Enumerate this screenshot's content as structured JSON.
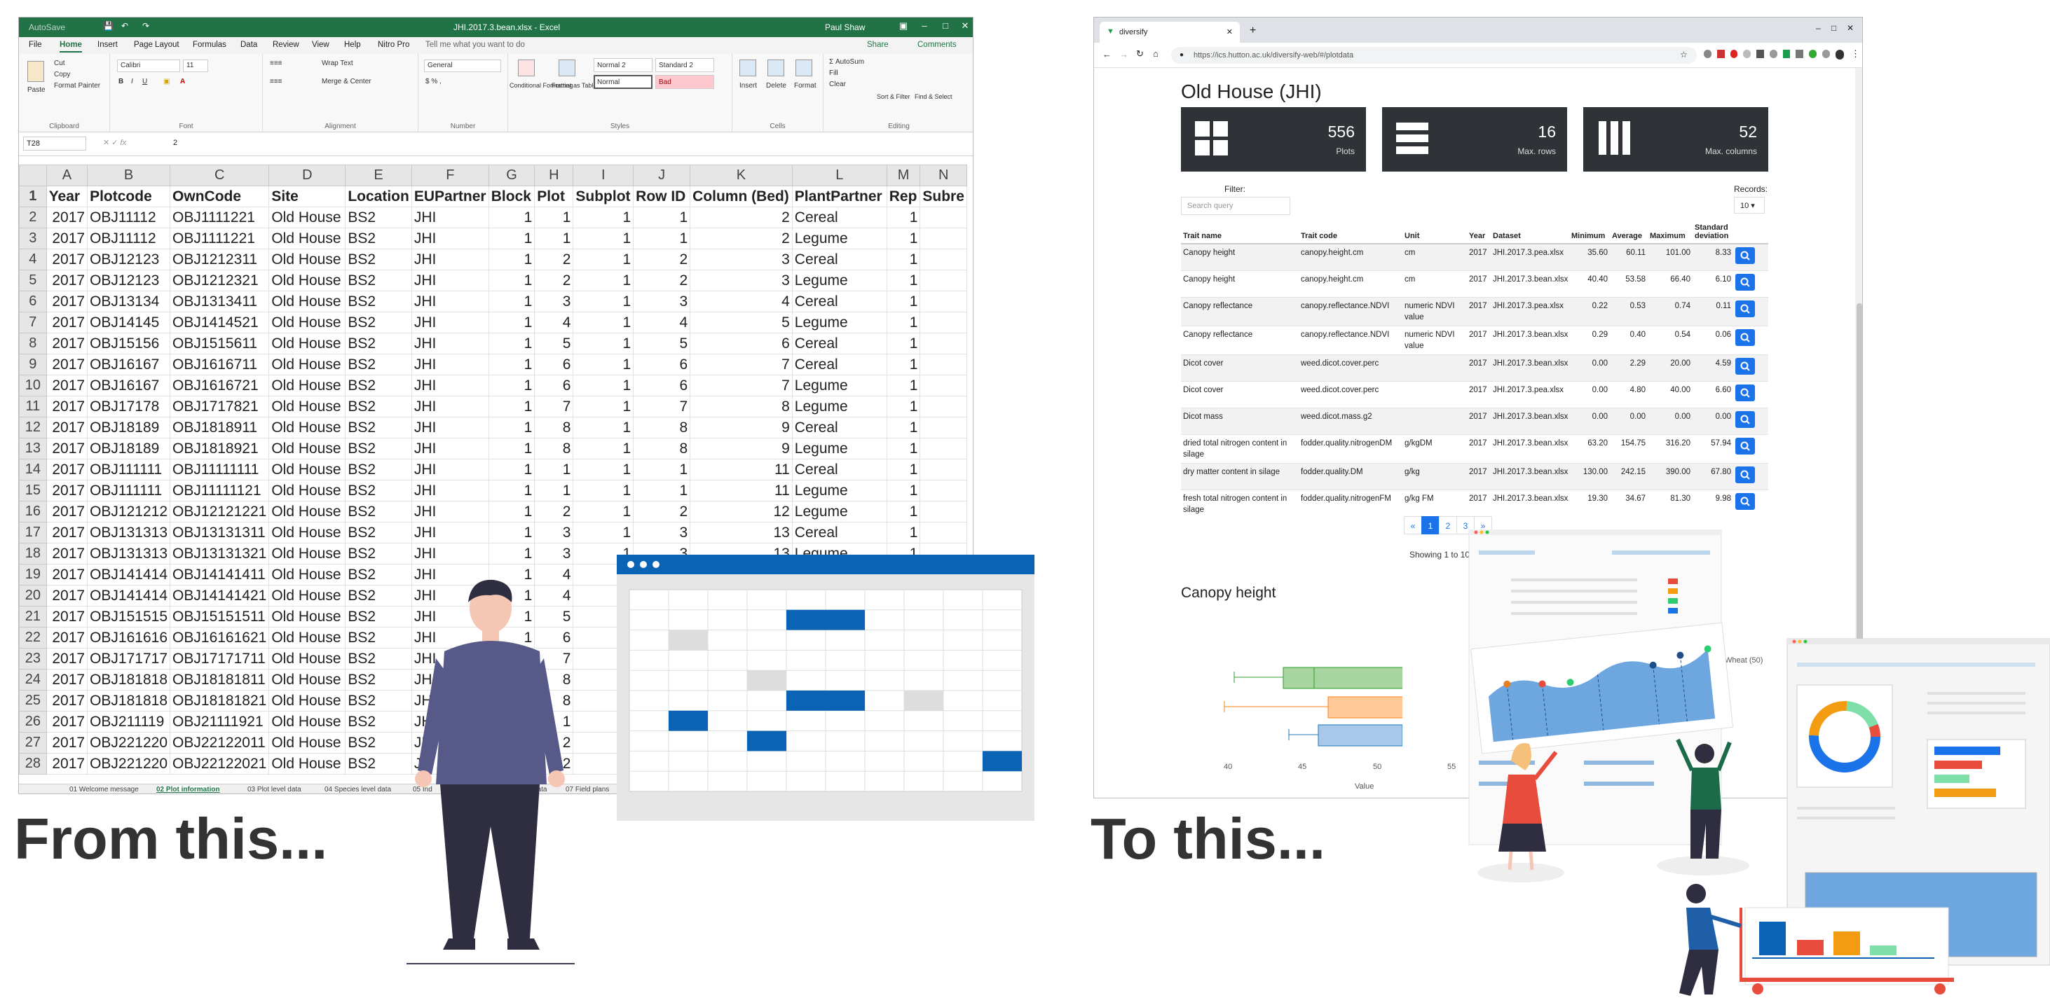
{
  "excel": {
    "title": "JHI.2017.3.bean.xlsx  -  Excel",
    "autosave": "AutoSave",
    "user": "Paul Shaw",
    "menu": [
      "File",
      "Home",
      "Insert",
      "Page Layout",
      "Formulas",
      "Data",
      "Review",
      "View",
      "Help",
      "Nitro Pro"
    ],
    "tell_me": "Tell me what you want to do",
    "share": "Share",
    "comments": "Comments",
    "ribbon": {
      "paste": "Paste",
      "cut": "Cut",
      "copy": "Copy",
      "format_painter": "Format Painter",
      "clipboard": "Clipboard",
      "font_name": "Calibri",
      "font_size": "11",
      "font": "Font",
      "wrap_text": "Wrap Text",
      "merge_center": "Merge & Center",
      "alignment": "Alignment",
      "number_format": "General",
      "number": "Number",
      "cond_format": "Conditional Formatting",
      "format_table": "Format as Table",
      "style_normal2": "Normal 2",
      "style_standard2": "Standard 2",
      "style_normal": "Normal",
      "style_bad": "Bad",
      "styles": "Styles",
      "insert": "Insert",
      "delete": "Delete",
      "format": "Format",
      "cells": "Cells",
      "autosum": "AutoSum",
      "fill": "Fill",
      "clear": "Clear",
      "sort_filter": "Sort & Filter",
      "find_select": "Find & Select",
      "editing": "Editing"
    },
    "name_box": "T28",
    "formula_value": "2",
    "columns": [
      "A",
      "B",
      "C",
      "D",
      "E",
      "F",
      "G",
      "H",
      "I",
      "J",
      "K",
      "L",
      "M",
      "N"
    ],
    "headers": [
      "Year",
      "Plotcode",
      "OwnCode",
      "Site",
      "Location",
      "EUPartner",
      "Block",
      "Plot",
      "Subplot",
      "Row ID",
      "Column (Bed)",
      "PlantPartner",
      "Rep",
      "Subre"
    ],
    "rows": [
      [
        "2017",
        "OBJ11112",
        "OBJ1111221",
        "Old House",
        "BS2",
        "JHI",
        "1",
        "1",
        "1",
        "1",
        "2",
        "Cereal",
        "1"
      ],
      [
        "2017",
        "OBJ11112",
        "OBJ1111221",
        "Old House",
        "BS2",
        "JHI",
        "1",
        "1",
        "1",
        "1",
        "2",
        "Legume",
        "1"
      ],
      [
        "2017",
        "OBJ12123",
        "OBJ1212311",
        "Old House",
        "BS2",
        "JHI",
        "1",
        "2",
        "1",
        "2",
        "3",
        "Cereal",
        "1"
      ],
      [
        "2017",
        "OBJ12123",
        "OBJ1212321",
        "Old House",
        "BS2",
        "JHI",
        "1",
        "2",
        "1",
        "2",
        "3",
        "Legume",
        "1"
      ],
      [
        "2017",
        "OBJ13134",
        "OBJ1313411",
        "Old House",
        "BS2",
        "JHI",
        "1",
        "3",
        "1",
        "3",
        "4",
        "Cereal",
        "1"
      ],
      [
        "2017",
        "OBJ14145",
        "OBJ1414521",
        "Old House",
        "BS2",
        "JHI",
        "1",
        "4",
        "1",
        "4",
        "5",
        "Legume",
        "1"
      ],
      [
        "2017",
        "OBJ15156",
        "OBJ1515611",
        "Old House",
        "BS2",
        "JHI",
        "1",
        "5",
        "1",
        "5",
        "6",
        "Cereal",
        "1"
      ],
      [
        "2017",
        "OBJ16167",
        "OBJ1616711",
        "Old House",
        "BS2",
        "JHI",
        "1",
        "6",
        "1",
        "6",
        "7",
        "Cereal",
        "1"
      ],
      [
        "2017",
        "OBJ16167",
        "OBJ1616721",
        "Old House",
        "BS2",
        "JHI",
        "1",
        "6",
        "1",
        "6",
        "7",
        "Legume",
        "1"
      ],
      [
        "2017",
        "OBJ17178",
        "OBJ1717821",
        "Old House",
        "BS2",
        "JHI",
        "1",
        "7",
        "1",
        "7",
        "8",
        "Legume",
        "1"
      ],
      [
        "2017",
        "OBJ18189",
        "OBJ1818911",
        "Old House",
        "BS2",
        "JHI",
        "1",
        "8",
        "1",
        "8",
        "9",
        "Cereal",
        "1"
      ],
      [
        "2017",
        "OBJ18189",
        "OBJ1818921",
        "Old House",
        "BS2",
        "JHI",
        "1",
        "8",
        "1",
        "8",
        "9",
        "Legume",
        "1"
      ],
      [
        "2017",
        "OBJ111111",
        "OBJ11111111",
        "Old House",
        "BS2",
        "JHI",
        "1",
        "1",
        "1",
        "1",
        "11",
        "Cereal",
        "1"
      ],
      [
        "2017",
        "OBJ111111",
        "OBJ11111121",
        "Old House",
        "BS2",
        "JHI",
        "1",
        "1",
        "1",
        "1",
        "11",
        "Legume",
        "1"
      ],
      [
        "2017",
        "OBJ121212",
        "OBJ12121221",
        "Old House",
        "BS2",
        "JHI",
        "1",
        "2",
        "1",
        "2",
        "12",
        "Legume",
        "1"
      ],
      [
        "2017",
        "OBJ131313",
        "OBJ13131311",
        "Old House",
        "BS2",
        "JHI",
        "1",
        "3",
        "1",
        "3",
        "13",
        "Cereal",
        "1"
      ],
      [
        "2017",
        "OBJ131313",
        "OBJ13131321",
        "Old House",
        "BS2",
        "JHI",
        "1",
        "3",
        "1",
        "3",
        "13",
        "Legume",
        "1"
      ],
      [
        "2017",
        "OBJ141414",
        "OBJ14141411",
        "Old House",
        "BS2",
        "JHI",
        "1",
        "4",
        "",
        "",
        "",
        "",
        ""
      ],
      [
        "2017",
        "OBJ141414",
        "OBJ14141421",
        "Old House",
        "BS2",
        "JHI",
        "1",
        "4",
        "",
        "",
        "",
        "",
        ""
      ],
      [
        "2017",
        "OBJ151515",
        "OBJ15151511",
        "Old House",
        "BS2",
        "JHI",
        "1",
        "5",
        "",
        "",
        "",
        "",
        ""
      ],
      [
        "2017",
        "OBJ161616",
        "OBJ16161621",
        "Old House",
        "BS2",
        "JHI",
        "1",
        "6",
        "",
        "",
        "",
        "",
        ""
      ],
      [
        "2017",
        "OBJ171717",
        "OBJ17171711",
        "Old House",
        "BS2",
        "JHI",
        "1",
        "7",
        "",
        "",
        "",
        "",
        ""
      ],
      [
        "2017",
        "OBJ181818",
        "OBJ18181811",
        "Old House",
        "BS2",
        "JHI",
        "1",
        "8",
        "",
        "",
        "",
        "",
        ""
      ],
      [
        "2017",
        "OBJ181818",
        "OBJ18181821",
        "Old House",
        "BS2",
        "JHI",
        "1",
        "8",
        "",
        "",
        "",
        "",
        ""
      ],
      [
        "2017",
        "OBJ211119",
        "OBJ21111921",
        "Old House",
        "BS2",
        "JH",
        "1",
        "1",
        "",
        "",
        "",
        "",
        ""
      ],
      [
        "2017",
        "OBJ221220",
        "OBJ22122011",
        "Old House",
        "BS2",
        "JH",
        "1",
        "2",
        "",
        "",
        "",
        "",
        ""
      ],
      [
        "2017",
        "OBJ221220",
        "OBJ22122021",
        "Old House",
        "BS2",
        "JH",
        "1",
        "2",
        "",
        "",
        "",
        "",
        ""
      ]
    ],
    "sheet_tabs": [
      "01 Welcome message",
      "02 Plot information",
      "03 Plot level data",
      "04 Species level data",
      "05 Ind",
      "data",
      "07 Field plans"
    ]
  },
  "browser": {
    "tab_title": "diversify",
    "url": "https://ics.hutton.ac.uk/diversify-web/#/plotdata",
    "page_title": "Old House (JHI)",
    "cards": [
      {
        "value": "556",
        "label": "Plots",
        "icon": "grid-icon"
      },
      {
        "value": "16",
        "label": "Max. rows",
        "icon": "rows-icon"
      },
      {
        "value": "52",
        "label": "Max. columns",
        "icon": "columns-icon"
      }
    ],
    "filter_label": "Filter:",
    "search_placeholder": "Search query",
    "records_label": "Records:",
    "records_value": "10",
    "table_headers": [
      "Trait name",
      "Trait code",
      "Unit",
      "Year",
      "Dataset",
      "Minimum",
      "Average",
      "Maximum",
      "Standard deviation"
    ],
    "table_rows": [
      [
        "Canopy height",
        "canopy.height.cm",
        "cm",
        "2017",
        "JHI.2017.3.pea.xlsx",
        "35.60",
        "60.11",
        "101.00",
        "8.33"
      ],
      [
        "Canopy height",
        "canopy.height.cm",
        "cm",
        "2017",
        "JHI.2017.3.bean.xlsx",
        "40.40",
        "53.58",
        "66.40",
        "6.10"
      ],
      [
        "Canopy reflectance",
        "canopy.reflectance.NDVI",
        "numeric NDVI value",
        "2017",
        "JHI.2017.3.pea.xlsx",
        "0.22",
        "0.53",
        "0.74",
        "0.11"
      ],
      [
        "Canopy reflectance",
        "canopy.reflectance.NDVI",
        "numeric NDVI value",
        "2017",
        "JHI.2017.3.bean.xlsx",
        "0.29",
        "0.40",
        "0.54",
        "0.06"
      ],
      [
        "Dicot cover",
        "weed.dicot.cover.perc",
        "",
        "2017",
        "JHI.2017.3.bean.xlsx",
        "0.00",
        "2.29",
        "20.00",
        "4.59"
      ],
      [
        "Dicot cover",
        "weed.dicot.cover.perc",
        "",
        "2017",
        "JHI.2017.3.pea.xlsx",
        "0.00",
        "4.80",
        "40.00",
        "6.60"
      ],
      [
        "Dicot mass",
        "weed.dicot.mass.g2",
        "",
        "2017",
        "JHI.2017.3.bean.xlsx",
        "0.00",
        "0.00",
        "0.00",
        "0.00"
      ],
      [
        "dried total nitrogen content in silage",
        "fodder.quality.nitrogenDM",
        "g/kgDM",
        "2017",
        "JHI.2017.3.bean.xlsx",
        "63.20",
        "154.75",
        "316.20",
        "57.94"
      ],
      [
        "dry matter content in silage",
        "fodder.quality.DM",
        "g/kg",
        "2017",
        "JHI.2017.3.bean.xlsx",
        "130.00",
        "242.15",
        "390.00",
        "67.80"
      ],
      [
        "fresh total nitrogen content in silage",
        "fodder.quality.nitrogenFM",
        "g/kg FM",
        "2017",
        "JHI.2017.3.bean.xlsx",
        "19.30",
        "34.67",
        "81.30",
        "9.98"
      ]
    ],
    "pager": [
      "«",
      "1",
      "2",
      "3",
      "»"
    ],
    "showing": "Showing 1 to 10",
    "chart_title": "Canopy height",
    "legend_fragment": "Wheat (50)",
    "x_ticks": [
      "40",
      "45",
      "50",
      "55"
    ],
    "x_label": "Value"
  },
  "captions": {
    "left": "From this...",
    "right": "To this..."
  },
  "colors": {
    "excel_green": "#217346",
    "accent_blue": "#1a73e8",
    "illus_blue": "#0b63b6",
    "card_dark": "#2f3338"
  }
}
